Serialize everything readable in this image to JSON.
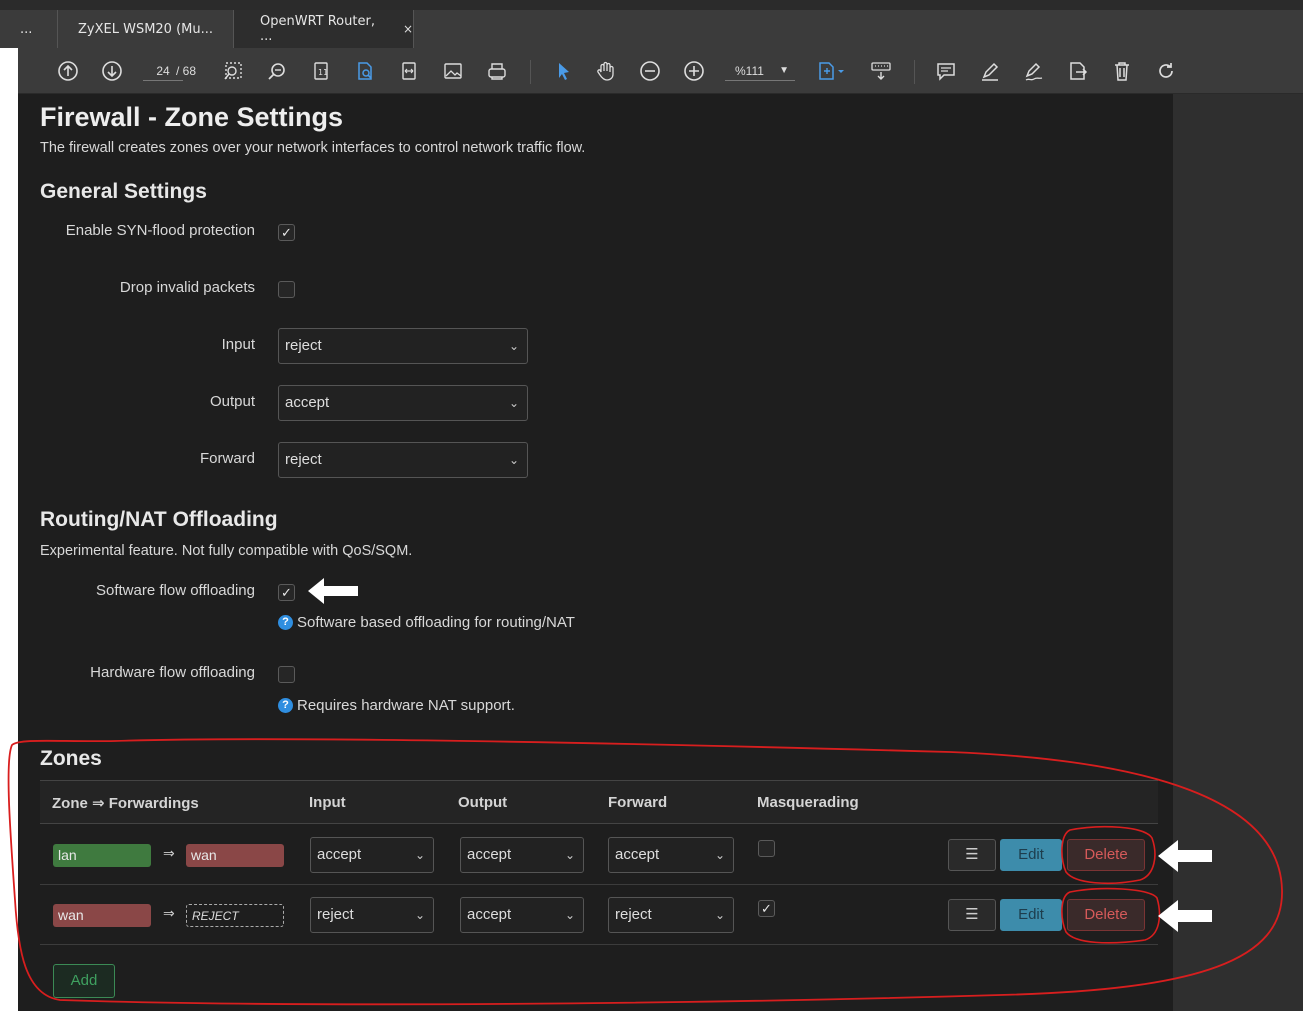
{
  "tabs": [
    {
      "label": "..."
    },
    {
      "label": "ZyXEL WSM20 (Mu..."
    },
    {
      "label": "OpenWRT Router, ...",
      "close": "×"
    }
  ],
  "toolbar": {
    "page_current": "24",
    "page_total": "/ 68",
    "zoom": "%111",
    "icons": [
      "prev-page-icon",
      "next-page-icon",
      "marquee-zoom-icon",
      "zoom-search-icon",
      "fit-page-icon",
      "find-icon",
      "fit-width-icon",
      "image-icon",
      "print-icon",
      "select-pointer-icon",
      "hand-icon",
      "zoom-out-icon",
      "zoom-in-icon",
      "page-tools-icon",
      "keyboard-icon",
      "comment-icon",
      "highlight-icon",
      "sign-icon",
      "export-icon",
      "delete-icon",
      "rotate-icon"
    ]
  },
  "page": {
    "title": "Firewall - Zone Settings",
    "description": "The firewall creates zones over your network interfaces to control network traffic flow.",
    "general_heading": "General Settings",
    "general": {
      "syn_flood_label": "Enable SYN-flood protection",
      "syn_flood_checked": "✓",
      "drop_invalid_label": "Drop invalid packets",
      "input_label": "Input",
      "input_value": "reject",
      "output_label": "Output",
      "output_value": "accept",
      "forward_label": "Forward",
      "forward_value": "reject"
    },
    "offload_heading": "Routing/NAT Offloading",
    "offload_desc": "Experimental feature. Not fully compatible with QoS/SQM.",
    "offload": {
      "software_label": "Software flow offloading",
      "software_checked": "✓",
      "software_help": "Software based offloading for routing/NAT",
      "hardware_label": "Hardware flow offloading",
      "hardware_help": "Requires hardware NAT support."
    },
    "zones_heading": "Zones",
    "zones_headers": {
      "zone": "Zone ⇒ Forwardings",
      "input": "Input",
      "output": "Output",
      "forward": "Forward",
      "masq": "Masquerading"
    },
    "zones": [
      {
        "zone": "lan",
        "arrow": "⇒",
        "forward_to": "wan",
        "input": "accept",
        "output": "accept",
        "forward": "accept",
        "masq": "",
        "menu": "☰",
        "edit": "Edit",
        "delete": "Delete"
      },
      {
        "zone": "wan",
        "arrow": "⇒",
        "forward_to": "REJECT",
        "input": "reject",
        "output": "accept",
        "forward": "reject",
        "masq": "✓",
        "menu": "☰",
        "edit": "Edit",
        "delete": "Delete"
      }
    ],
    "add_label": "Add",
    "chevron": "⌄",
    "help_glyph": "?"
  },
  "colors": {
    "annotation_red": "#d81e1e",
    "lan_badge": "#3f7a3f",
    "wan_badge": "#8a4747",
    "edit_button": "#3d8cab"
  }
}
